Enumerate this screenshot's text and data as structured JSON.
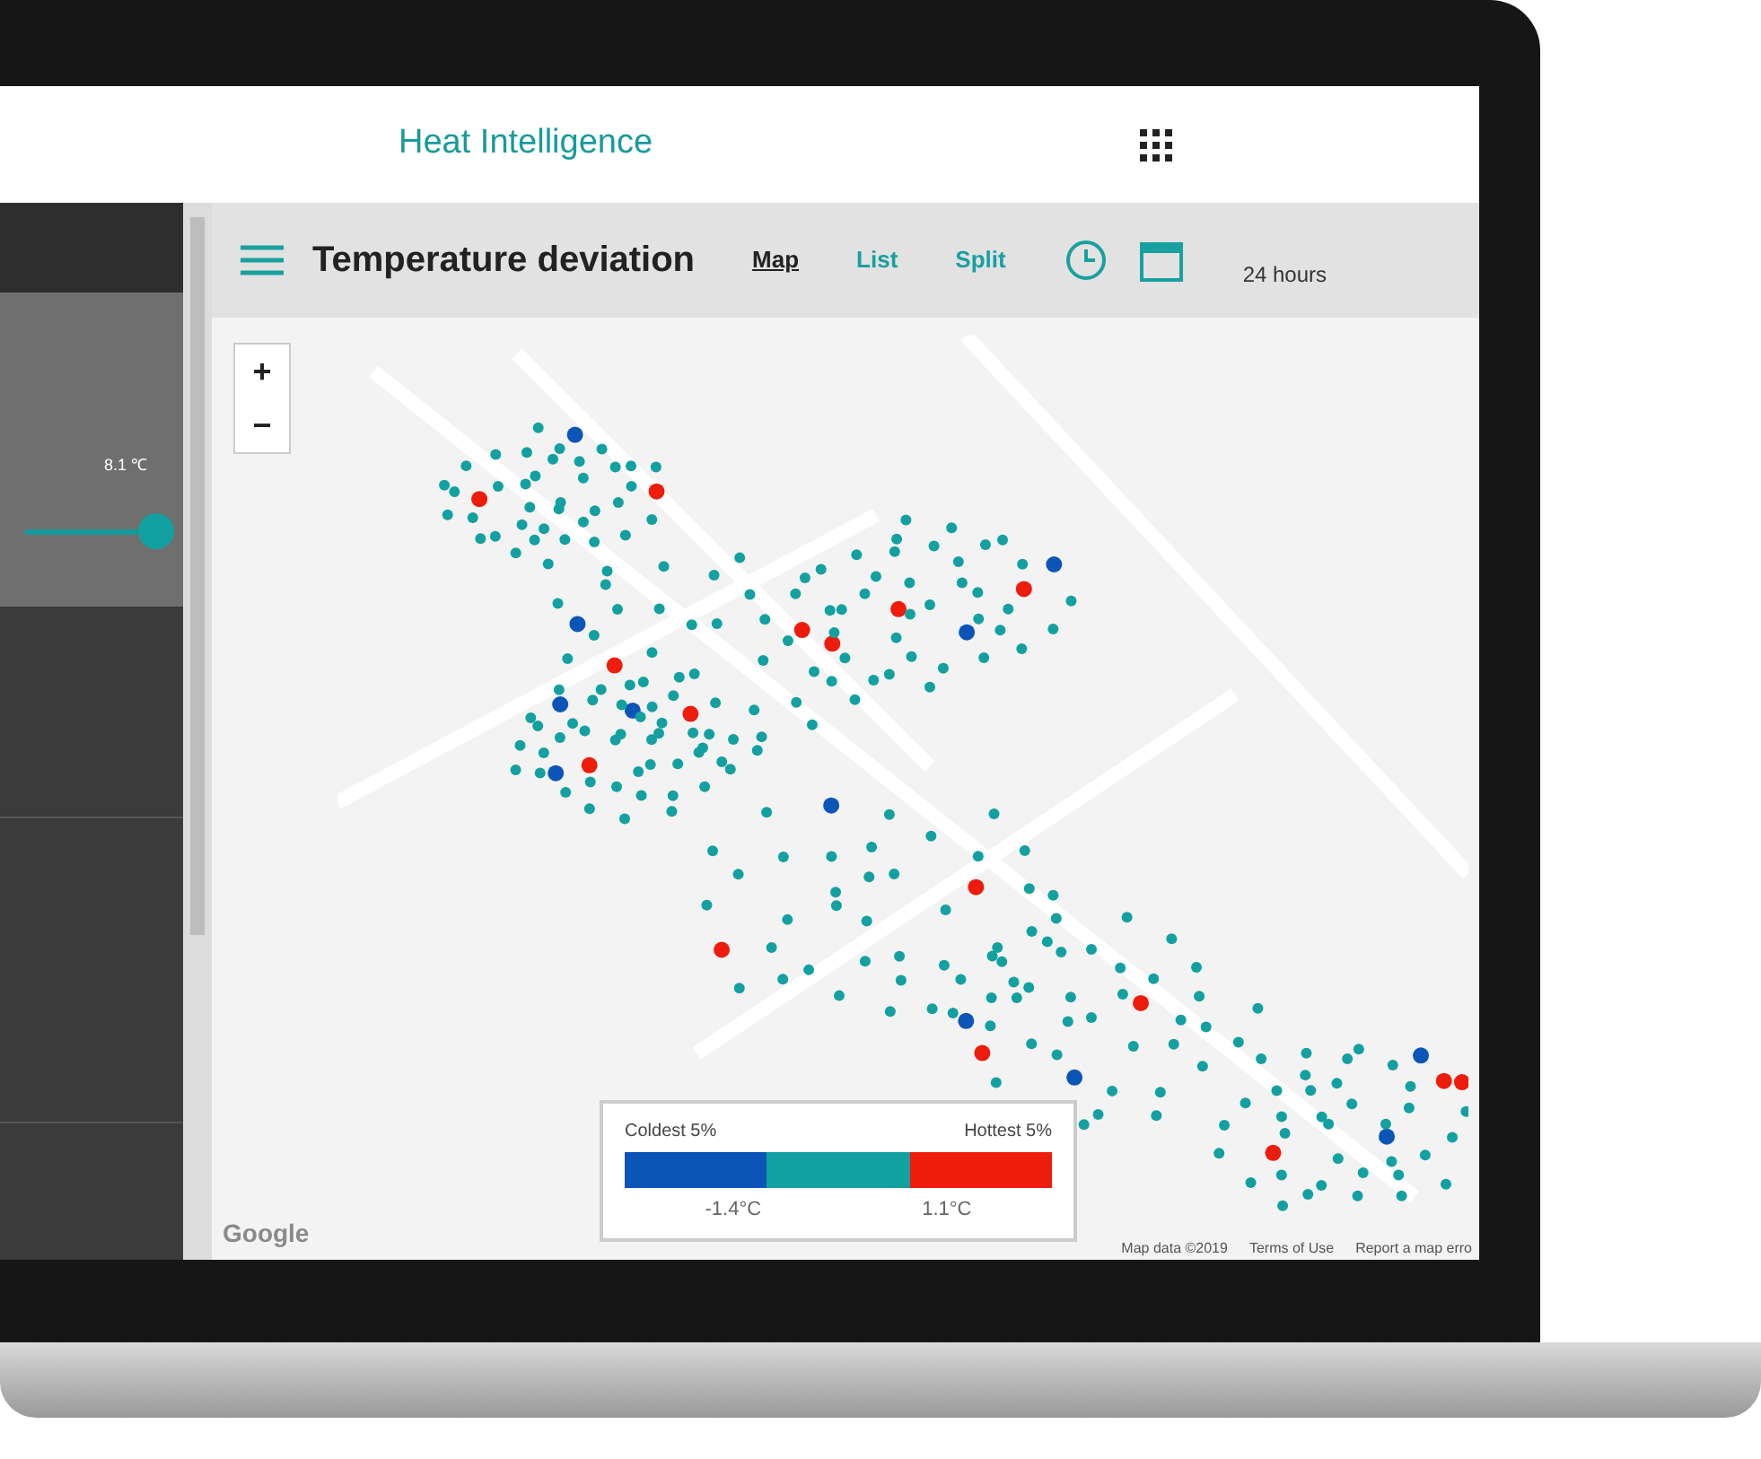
{
  "app_bar": {
    "title": "Heat Intelligence"
  },
  "side_panel": {
    "slider": {
      "reading": "8.1 ℃",
      "level": 0.96
    }
  },
  "map_panel": {
    "title": "Temperature deviation",
    "tabs": [
      {
        "label": "Map",
        "selected": true
      },
      {
        "label": "List",
        "selected": false
      },
      {
        "label": "Split",
        "selected": false
      }
    ],
    "period": "24 hours",
    "zoom": [
      "+",
      "−"
    ],
    "legend": {
      "low_label": "Coldest 5%",
      "high_label": "Hottest 5%",
      "low_value": "-1.4°C",
      "high_value": "1.1°C",
      "bands": [
        {
          "color": "#0b55b8"
        },
        {
          "color": "#13a0a0"
        },
        {
          "color": "#ee1c0c"
        }
      ]
    },
    "map_logo": "Google",
    "attribution": [
      "Map data ©2019",
      "Terms of Use",
      "Report a map erro"
    ]
  }
}
